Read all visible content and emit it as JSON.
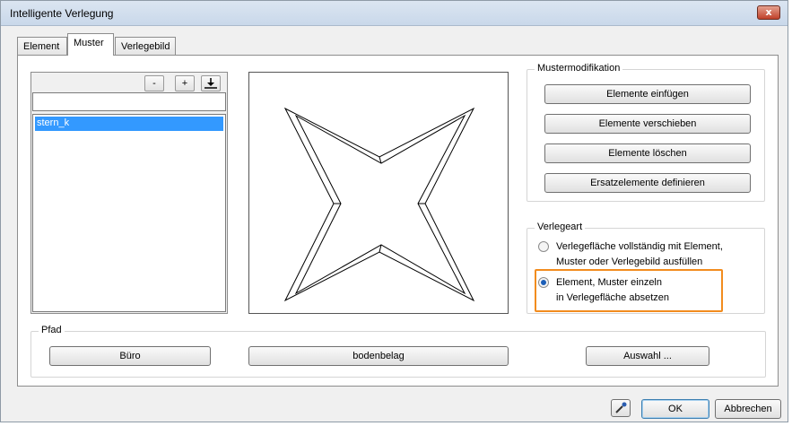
{
  "window": {
    "title": "Intelligente Verlegung",
    "close_label": "x"
  },
  "tabs": [
    {
      "label": "Element",
      "active": false
    },
    {
      "label": "Muster",
      "active": true
    },
    {
      "label": "Verlegebild",
      "active": false
    }
  ],
  "pattern_list": {
    "remove_label": "-",
    "add_label": "+",
    "import_icon": "download-icon",
    "name_value": "",
    "items": [
      "stern_k"
    ],
    "selected": "stern_k"
  },
  "mustermodifikation": {
    "legend": "Mustermodifikation",
    "buttons": [
      "Elemente einfügen",
      "Elemente verschieben",
      "Elemente löschen",
      "Ersatzelemente definieren"
    ]
  },
  "verlegeart": {
    "legend": "Verlegeart",
    "option1_line1": "Verlegefläche vollständig mit Element,",
    "option1_line2": "Muster oder Verlegebild ausfüllen",
    "option2_line1": "Element, Muster einzeln",
    "option2_line2": "in Verlegefläche absetzen",
    "selected_option": 2,
    "highlight_color": "#f28c1e"
  },
  "pfad": {
    "legend": "Pfad",
    "folder1": "Büro",
    "folder2": "bodenbelag",
    "select_button": "Auswahl ..."
  },
  "footer": {
    "picker_icon": "eyedropper-icon",
    "ok_label": "OK",
    "cancel_label": "Abbrechen"
  },
  "colors": {
    "selection": "#3399ff",
    "highlight": "#f28c1e"
  }
}
